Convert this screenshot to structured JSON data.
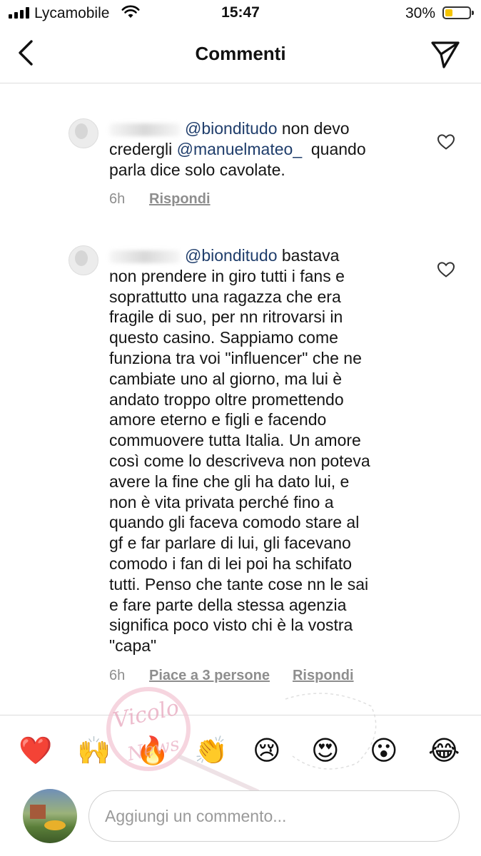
{
  "status_bar": {
    "carrier": "Lycamobile",
    "time": "15:47",
    "battery": "30%",
    "battery_level": 0.3
  },
  "header": {
    "title": "Commenti"
  },
  "comments": [
    {
      "mention": "@bionditudo",
      "lines": [
        {
          "mention": "@bionditudo",
          "text": " non devo"
        },
        {
          "text": "credergli ",
          "mention": "@manuelmateo_",
          "text_after": "  quando"
        },
        {
          "text": "parla dice solo cavolate."
        }
      ],
      "time": "6h",
      "reply": "Rispondi"
    },
    {
      "lines": [
        {
          "mention": "@bionditudo",
          "text": " bastava"
        },
        {
          "text": "non prendere in giro tutti i fans e"
        },
        {
          "text": "soprattutto una ragazza che era"
        },
        {
          "text": "fragile di suo, per nn ritrovarsi in"
        },
        {
          "text": "questo casino. Sappiamo come"
        },
        {
          "text": "funziona tra voi \"influencer\" che ne"
        },
        {
          "text": "cambiate uno al giorno, ma lui è"
        },
        {
          "text": "andato troppo oltre promettendo"
        },
        {
          "text": "amore eterno e figli e facendo"
        },
        {
          "text": "commuovere tutta Italia. Un amore"
        },
        {
          "text": "così come lo descriveva non poteva"
        },
        {
          "text": "avere la fine che gli ha dato lui, e"
        },
        {
          "text": "non è vita privata perché fino a"
        },
        {
          "text": "quando gli faceva comodo stare al"
        },
        {
          "text": "gf e far parlare di lui, gli facevano"
        },
        {
          "text": "comodo i fan di lei poi ha schifato"
        },
        {
          "text": "tutti. Penso che tante cose nn le sai"
        },
        {
          "text": "e fare parte della stessa agenzia"
        },
        {
          "text": "significa poco visto chi è  la vostra"
        },
        {
          "text": "\"capa\""
        }
      ],
      "time": "6h",
      "likes": "Piace a 3 persone",
      "reply": "Rispondi"
    }
  ],
  "emoji_bar": [
    "❤️",
    "🙌",
    "🔥",
    "👏",
    "😢",
    "😍",
    "😮",
    "😂"
  ],
  "watermark": {
    "text": "Vicolo delle News"
  },
  "composer": {
    "placeholder": "Aggiungi un commento..."
  },
  "icons": {
    "back": "chevron-left-icon",
    "send": "paper-plane-icon",
    "like": "heart-outline-icon",
    "wifi": "wifi-icon",
    "signal": "signal-bars-icon",
    "battery": "battery-icon"
  }
}
